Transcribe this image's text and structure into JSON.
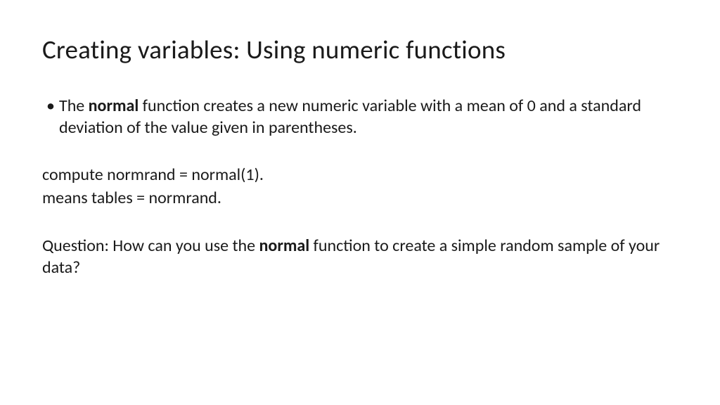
{
  "slide": {
    "title": "Creating variables:  Using numeric functions",
    "bullet1_part1": "The ",
    "bullet1_bold": "normal",
    "bullet1_part2": " function creates a new numeric variable with a mean of 0 and a standard deviation of the value given in parentheses.",
    "code_line1": "compute normrand = normal(1).",
    "code_line2": "means tables =  normrand.",
    "question_part1": "Question:  How can you use the ",
    "question_bold": "normal",
    "question_part2": " function to create a simple random sample of your data?"
  }
}
